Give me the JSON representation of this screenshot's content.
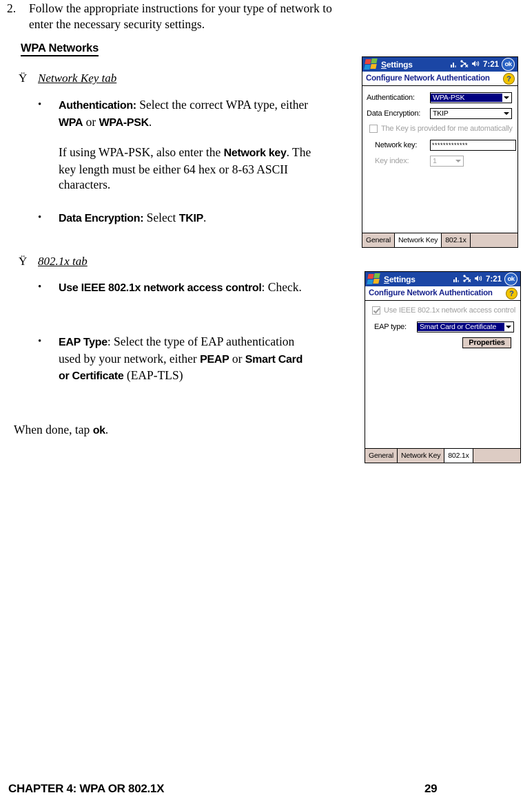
{
  "document": {
    "step": {
      "number": "2.",
      "text": "Follow the appropriate instructions for your type of network to enter the necessary security settings."
    },
    "section_heading": "WPA Networks",
    "sub_heading_1": {
      "marker": "Ÿ",
      "label": "Network Key tab"
    },
    "bullets_1": [
      {
        "bullet": "•",
        "bold": "Authentication:",
        "rest": " Select the correct WPA type, either ",
        "bold2": "WPA",
        "mid": " or ",
        "bold3": "WPA-PSK",
        "end": "."
      },
      {
        "bullet": "•",
        "bold": "Data Encryption:",
        "rest": " Select ",
        "bold2": "TKIP",
        "end": "."
      }
    ],
    "paragraph_1": {
      "pre": "If using WPA-PSK, also enter the ",
      "bold": "Network key",
      "post": ". The key length must be either 64 hex or 8-63 ASCII characters."
    },
    "sub_heading_2": {
      "marker": "Ÿ",
      "label": "802.1x tab"
    },
    "bullets_2": [
      {
        "bullet": "•",
        "bold": "Use IEEE 802.1x network access control",
        "rest": ": Check."
      },
      {
        "bullet": "•",
        "bold": "EAP Type",
        "rest": ": Select the type of EAP authentication used by your network, either ",
        "bold2": "PEAP",
        "mid": " or ",
        "bold3": "Smart Card or Certificate",
        "end": " (EAP-TLS)"
      }
    ],
    "closing": {
      "pre": "When done, tap ",
      "bold": "ok",
      "post": "."
    },
    "footer": {
      "chapter": "CHAPTER 4: WPA OR 802.1X",
      "page": "29"
    }
  },
  "screenshot_1": {
    "titlebar": {
      "app": "Settings",
      "app_underline_char": "S",
      "time": "7:21",
      "ok_label": "ok",
      "icons": [
        "signal-bars-icon",
        "network-disconnected-icon",
        "speaker-icon"
      ]
    },
    "subtitle": {
      "text": "Configure Network Authentication",
      "help_label": "?"
    },
    "fields": {
      "authentication_label": "Authentication:",
      "authentication_value": "WPA-PSK",
      "data_encryption_label": "Data Encryption:",
      "data_encryption_value": "TKIP",
      "auto_key_checkbox_label": "The Key is provided for me automatically",
      "auto_key_checked": false,
      "network_key_label": "Network key:",
      "network_key_value": "*************",
      "key_index_label": "Key index:",
      "key_index_value": "1"
    },
    "tabs": [
      {
        "label": "General",
        "active": false
      },
      {
        "label": "Network Key",
        "active": true
      },
      {
        "label": "802.1x",
        "active": false
      }
    ]
  },
  "screenshot_2": {
    "titlebar": {
      "app": "Settings",
      "app_underline_char": "S",
      "time": "7:21",
      "ok_label": "ok",
      "icons": [
        "signal-bars-icon",
        "network-disconnected-icon",
        "speaker-icon"
      ]
    },
    "subtitle": {
      "text": "Configure Network Authentication",
      "help_label": "?"
    },
    "fields": {
      "use_8021x_label": "Use IEEE 802.1x network access control",
      "use_8021x_checked": true,
      "eap_type_label": "EAP type:",
      "eap_type_value": "Smart Card or Certificate",
      "properties_button": "Properties"
    },
    "tabs": [
      {
        "label": "General",
        "active": false
      },
      {
        "label": "Network Key",
        "active": false
      },
      {
        "label": "802.1x",
        "active": true
      }
    ]
  },
  "colors": {
    "titlebar_blue": "#1b46a5",
    "subtitle_navy": "#17238c",
    "selection_navy": "#000080",
    "tab_beige": "#ddccc4",
    "help_yellow": "#f2c400"
  }
}
